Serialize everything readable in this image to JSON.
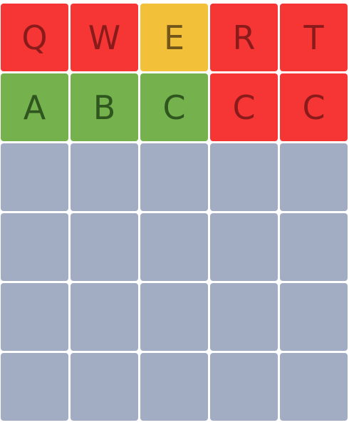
{
  "colors": {
    "absent": "#f63535",
    "present": "#f3c03a",
    "correct": "#75b24e",
    "empty": "#a2adc4"
  },
  "rows": [
    [
      {
        "letter": "Q",
        "state": "absent"
      },
      {
        "letter": "W",
        "state": "absent"
      },
      {
        "letter": "E",
        "state": "present"
      },
      {
        "letter": "R",
        "state": "absent"
      },
      {
        "letter": "T",
        "state": "absent"
      }
    ],
    [
      {
        "letter": "A",
        "state": "correct"
      },
      {
        "letter": "B",
        "state": "correct"
      },
      {
        "letter": "C",
        "state": "correct"
      },
      {
        "letter": "C",
        "state": "absent"
      },
      {
        "letter": "C",
        "state": "absent"
      }
    ],
    [
      {
        "letter": "",
        "state": "empty"
      },
      {
        "letter": "",
        "state": "empty"
      },
      {
        "letter": "",
        "state": "empty"
      },
      {
        "letter": "",
        "state": "empty"
      },
      {
        "letter": "",
        "state": "empty"
      }
    ],
    [
      {
        "letter": "",
        "state": "empty"
      },
      {
        "letter": "",
        "state": "empty"
      },
      {
        "letter": "",
        "state": "empty"
      },
      {
        "letter": "",
        "state": "empty"
      },
      {
        "letter": "",
        "state": "empty"
      }
    ],
    [
      {
        "letter": "",
        "state": "empty"
      },
      {
        "letter": "",
        "state": "empty"
      },
      {
        "letter": "",
        "state": "empty"
      },
      {
        "letter": "",
        "state": "empty"
      },
      {
        "letter": "",
        "state": "empty"
      }
    ],
    [
      {
        "letter": "",
        "state": "empty"
      },
      {
        "letter": "",
        "state": "empty"
      },
      {
        "letter": "",
        "state": "empty"
      },
      {
        "letter": "",
        "state": "empty"
      },
      {
        "letter": "",
        "state": "empty"
      }
    ]
  ]
}
